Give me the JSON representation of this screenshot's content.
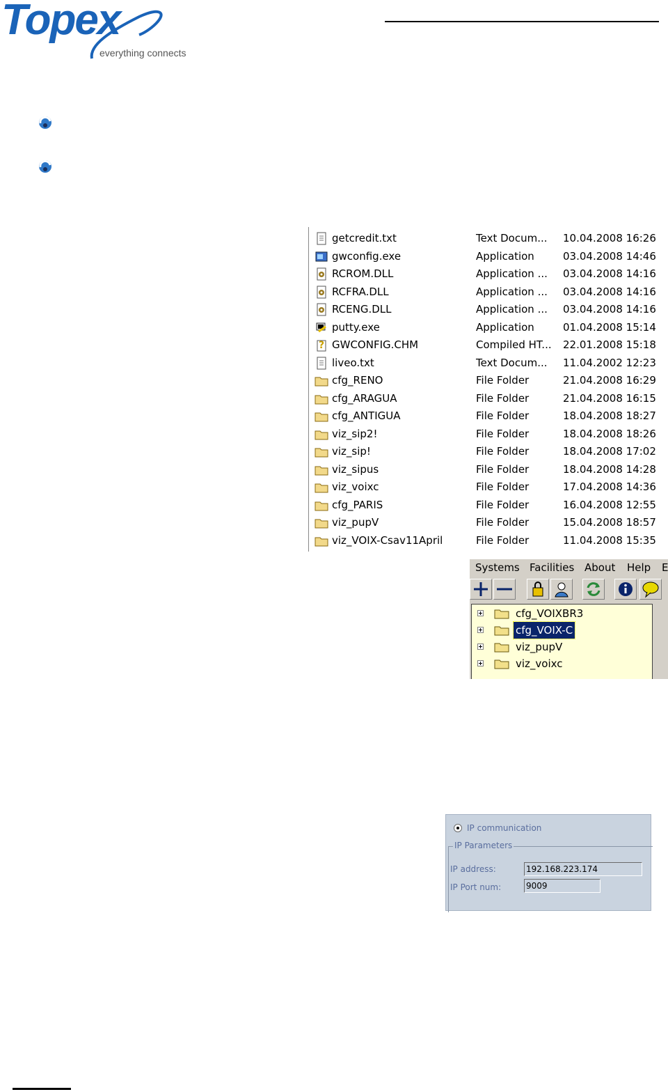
{
  "header": {
    "logo_word": "Topex",
    "logo_tagline": "everything connects"
  },
  "brand_colors": {
    "logo_blue": "#1a63b8",
    "selection": "#0a246a",
    "tree_bg": "#ffffd8"
  },
  "explorer": {
    "files": [
      {
        "name": "getcredit.txt",
        "type": "Text Docum...",
        "date": "10.04.2008 16:26",
        "icon": "text-document-icon"
      },
      {
        "name": "gwconfig.exe",
        "type": "Application",
        "date": "03.04.2008 14:46",
        "icon": "application-icon"
      },
      {
        "name": "RCROM.DLL",
        "type": "Application ...",
        "date": "03.04.2008 14:16",
        "icon": "dll-icon"
      },
      {
        "name": "RCFRA.DLL",
        "type": "Application ...",
        "date": "03.04.2008 14:16",
        "icon": "dll-icon"
      },
      {
        "name": "RCENG.DLL",
        "type": "Application ...",
        "date": "03.04.2008 14:16",
        "icon": "dll-icon"
      },
      {
        "name": "putty.exe",
        "type": "Application",
        "date": "01.04.2008 15:14",
        "icon": "putty-icon"
      },
      {
        "name": "GWCONFIG.CHM",
        "type": "Compiled HT...",
        "date": "22.01.2008 15:18",
        "icon": "help-file-icon"
      },
      {
        "name": "liveo.txt",
        "type": "Text Docum...",
        "date": "11.04.2002 12:23",
        "icon": "text-document-icon"
      },
      {
        "name": "cfg_RENO",
        "type": "File Folder",
        "date": "21.04.2008 16:29",
        "icon": "folder-icon"
      },
      {
        "name": "cfg_ARAGUA",
        "type": "File Folder",
        "date": "21.04.2008 16:15",
        "icon": "folder-icon"
      },
      {
        "name": "cfg_ANTIGUA",
        "type": "File Folder",
        "date": "18.04.2008 18:27",
        "icon": "folder-icon"
      },
      {
        "name": "viz_sip2!",
        "type": "File Folder",
        "date": "18.04.2008 18:26",
        "icon": "folder-icon"
      },
      {
        "name": "viz_sip!",
        "type": "File Folder",
        "date": "18.04.2008 17:02",
        "icon": "folder-icon"
      },
      {
        "name": "viz_sipus",
        "type": "File Folder",
        "date": "18.04.2008 14:28",
        "icon": "folder-icon"
      },
      {
        "name": "viz_voixc",
        "type": "File Folder",
        "date": "17.04.2008 14:36",
        "icon": "folder-icon"
      },
      {
        "name": "cfg_PARIS",
        "type": "File Folder",
        "date": "16.04.2008 12:55",
        "icon": "folder-icon"
      },
      {
        "name": "viz_pupV",
        "type": "File Folder",
        "date": "15.04.2008 18:57",
        "icon": "folder-icon"
      },
      {
        "name": "viz_VOIX-Csav11April",
        "type": "File Folder",
        "date": "11.04.2008 15:35",
        "icon": "folder-icon"
      }
    ]
  },
  "system_app": {
    "menu": [
      "Systems",
      "Facilities",
      "About",
      "Help",
      "E"
    ],
    "toolbar_icons": [
      "plus-icon",
      "minus-icon",
      "lock-icon",
      "user-icon",
      "refresh-icon",
      "info-icon",
      "help-bubble-icon"
    ],
    "tree": [
      {
        "label": "cfg_VOIXBR3",
        "selected": false
      },
      {
        "label": "cfg_VOIX-C",
        "selected": true
      },
      {
        "label": "viz_pupV",
        "selected": false
      },
      {
        "label": "viz_voixc",
        "selected": false
      }
    ]
  },
  "ip_panel": {
    "radio_label": "IP communication",
    "group_title": "IP Parameters",
    "address_label": "IP address:",
    "address_value": "192.168.223.174",
    "port_label": "IP Port num:",
    "port_value": "9009"
  }
}
